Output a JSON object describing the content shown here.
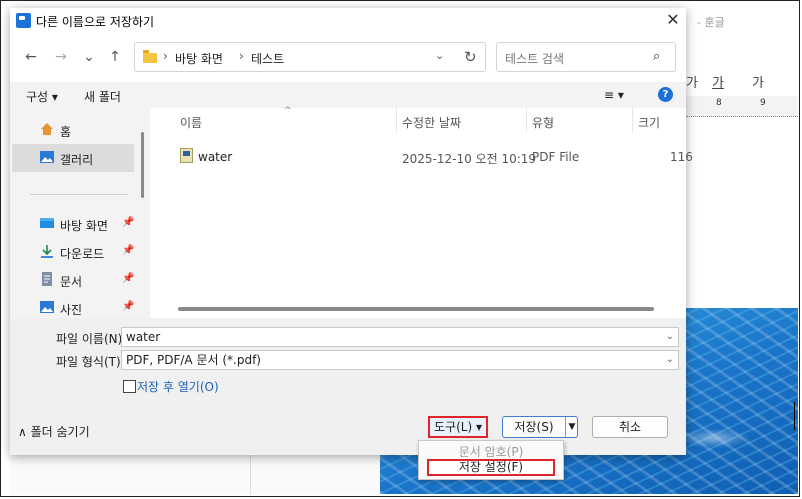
{
  "window": {
    "title": "다른 이름으로 저장하기",
    "close": "✕"
  },
  "nav": {
    "back": "←",
    "forward": "→",
    "recent": "⌄",
    "up": "↑",
    "refresh": "↻"
  },
  "address": {
    "crumb1": "바탕 화면",
    "crumb2": "테스트",
    "sep": "›"
  },
  "search": {
    "placeholder": "테스트 검색"
  },
  "toolbar": {
    "organize": "구성 ▾",
    "new_folder": "새 폴더",
    "view": "≡ ▾",
    "help": "?"
  },
  "sidebar": {
    "items": [
      {
        "label": "홈"
      },
      {
        "label": "갤러리"
      },
      {
        "label": "바탕 화면"
      },
      {
        "label": "다운로드"
      },
      {
        "label": "문서"
      },
      {
        "label": "사진"
      }
    ]
  },
  "filelist": {
    "columns": [
      "이름",
      "수정한 날짜",
      "유형",
      "크기"
    ],
    "rows": [
      {
        "name": "water",
        "modified": "2025-12-10 오전 10:19",
        "type": "PDF File",
        "size": "116"
      }
    ]
  },
  "form": {
    "filename_label": "파일 이름(N):",
    "filename_value": "water",
    "filetype_label": "파일 형식(T):",
    "filetype_value": "PDF, PDF/A 문서 (*.pdf)",
    "open_after_label": "저장 후 열기(O)"
  },
  "footer": {
    "hide_folders": "∧ 폴더 숨기기",
    "tools": "도구(L) ▾",
    "save": "저장(S)",
    "cancel": "취소"
  },
  "tools_menu": {
    "item1": "문서 암호(P)",
    "item2": "저장 설정(F)"
  },
  "background_app": {
    "title": "- 훈글",
    "fmt1": "가",
    "fmt2": "가",
    "fmt3": "가",
    "ruler8": "8",
    "ruler9": "9"
  },
  "colors": {
    "accent": "#1a6fd8",
    "highlight": "#e0242e",
    "folder": "#f4c542"
  }
}
